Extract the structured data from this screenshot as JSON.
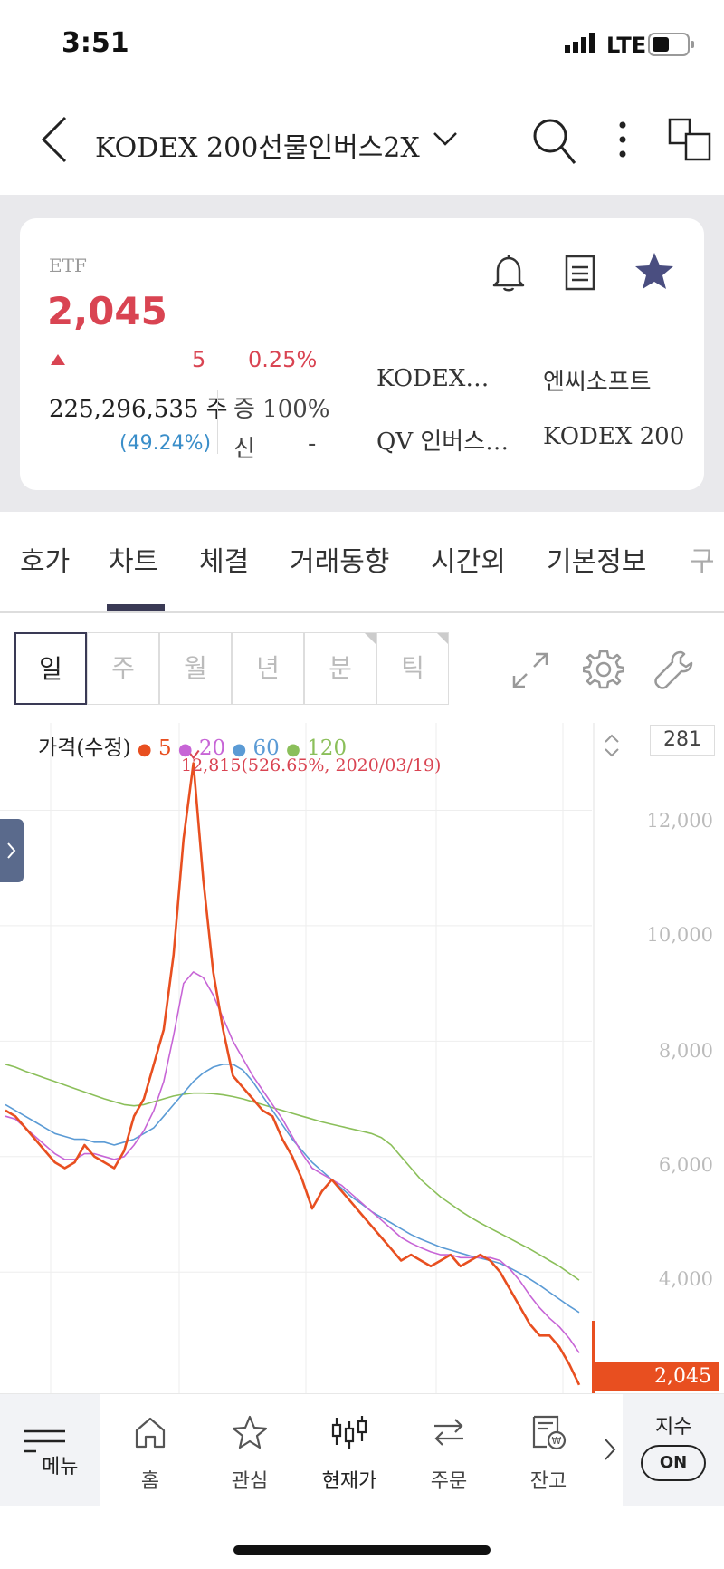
{
  "status": {
    "time": "3:51",
    "network": "LTE"
  },
  "header": {
    "title": "KODEX 200선물인버스2X"
  },
  "summary": {
    "type_label": "ETF",
    "price": "2,045",
    "change": "5",
    "change_pct": "0.25%",
    "volume": "225,296,535 주",
    "volume_ratio": "(49.24%)",
    "margin": "증 100%",
    "credit_label": "신",
    "credit_value": "-",
    "related": [
      "KODEX…",
      "엔씨소프트",
      "QV 인버스…",
      "KODEX 200"
    ]
  },
  "tabs": [
    "호가",
    "차트",
    "체결",
    "거래동향",
    "시간외",
    "기본정보",
    "구"
  ],
  "active_tab": "차트",
  "periods": [
    "일",
    "주",
    "월",
    "년",
    "분",
    "틱"
  ],
  "active_period": "일",
  "chart_legend": {
    "price_label": "가격(수정)",
    "ma": [
      {
        "label": "5",
        "color": "#e84f20"
      },
      {
        "label": "20",
        "color": "#c765d6"
      },
      {
        "label": "60",
        "color": "#5b9bd5"
      },
      {
        "label": "120",
        "color": "#8bbf5a"
      }
    ]
  },
  "chart_count": "281",
  "peak_annotation": "12,815(526.65%, 2020/03/19)",
  "last_price_label": "2,045",
  "chart_data": {
    "type": "line",
    "title": "",
    "y_ticks": [
      "12,000",
      "10,000",
      "8,000",
      "6,000",
      "4,000"
    ],
    "ylim": [
      1900,
      13200
    ],
    "peak": {
      "value": 12815,
      "date": "2020/03/19"
    },
    "last_value": 2045,
    "series": [
      {
        "name": "가격(수정)",
        "color": "#e84f20",
        "values": [
          6800,
          6700,
          6500,
          6300,
          6100,
          5900,
          5800,
          5900,
          6200,
          6000,
          5900,
          5800,
          6100,
          6700,
          7000,
          7600,
          8200,
          9500,
          11500,
          12815,
          10800,
          9200,
          8200,
          7400,
          7200,
          7000,
          6800,
          6700,
          6300,
          6000,
          5600,
          5100,
          5400,
          5600,
          5400,
          5200,
          5000,
          4800,
          4600,
          4400,
          4200,
          4300,
          4200,
          4100,
          4200,
          4300,
          4100,
          4200,
          4300,
          4200,
          4000,
          3700,
          3400,
          3100,
          2900,
          2900,
          2700,
          2400,
          2045
        ]
      },
      {
        "name": "20",
        "color": "#c765d6",
        "values": [
          6700,
          6650,
          6500,
          6350,
          6200,
          6050,
          5950,
          5950,
          6050,
          6050,
          6000,
          5950,
          6000,
          6200,
          6450,
          6800,
          7300,
          8100,
          9000,
          9200,
          9100,
          8800,
          8400,
          8000,
          7700,
          7400,
          7150,
          6900,
          6650,
          6350,
          6050,
          5800,
          5700,
          5600,
          5500,
          5350,
          5200,
          5050,
          4900,
          4750,
          4600,
          4500,
          4420,
          4350,
          4300,
          4300,
          4250,
          4250,
          4250,
          4250,
          4200,
          4050,
          3850,
          3600,
          3380,
          3200,
          3050,
          2850,
          2600
        ]
      },
      {
        "name": "60",
        "color": "#5b9bd5",
        "values": [
          6900,
          6800,
          6700,
          6600,
          6500,
          6400,
          6350,
          6300,
          6300,
          6250,
          6250,
          6200,
          6250,
          6300,
          6400,
          6500,
          6700,
          6900,
          7100,
          7300,
          7450,
          7550,
          7600,
          7600,
          7500,
          7300,
          7050,
          6800,
          6550,
          6300,
          6100,
          5900,
          5750,
          5600,
          5450,
          5300,
          5180,
          5050,
          4950,
          4850,
          4750,
          4650,
          4570,
          4500,
          4430,
          4380,
          4330,
          4280,
          4240,
          4200,
          4150,
          4070,
          3980,
          3880,
          3770,
          3650,
          3530,
          3410,
          3300
        ]
      },
      {
        "name": "120",
        "color": "#8bbf5a",
        "values": [
          7600,
          7550,
          7480,
          7420,
          7360,
          7300,
          7240,
          7180,
          7120,
          7060,
          7000,
          6950,
          6900,
          6880,
          6900,
          6950,
          7000,
          7050,
          7080,
          7100,
          7100,
          7090,
          7070,
          7040,
          7000,
          6950,
          6900,
          6850,
          6800,
          6750,
          6700,
          6650,
          6600,
          6560,
          6520,
          6480,
          6440,
          6400,
          6330,
          6200,
          6000,
          5800,
          5600,
          5450,
          5300,
          5180,
          5060,
          4950,
          4850,
          4760,
          4670,
          4580,
          4490,
          4400,
          4300,
          4200,
          4100,
          3980,
          3860
        ]
      }
    ]
  },
  "bottom_nav": {
    "menu": "메뉴",
    "items": [
      "홈",
      "관심",
      "현재가",
      "주문",
      "잔고"
    ],
    "index_label": "지수",
    "index_toggle": "ON"
  }
}
